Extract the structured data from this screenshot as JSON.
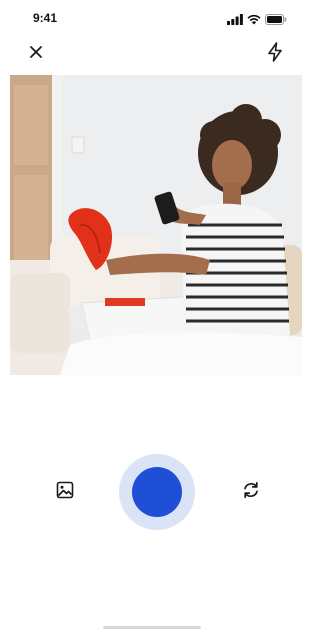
{
  "status_bar": {
    "time": "9:41",
    "icons": [
      "cellular-signal-icon",
      "wifi-icon",
      "battery-icon"
    ]
  },
  "top_bar": {
    "close_icon": "close-icon",
    "flash_icon": "flash-icon"
  },
  "viewfinder": {
    "subject_icon": "photo-preview"
  },
  "controls": {
    "gallery_icon": "gallery-icon",
    "shutter_icon": "shutter-button",
    "flip_icon": "flip-camera-icon"
  },
  "colors": {
    "shutter_inner": "#1f4fd6",
    "shutter_ring": "#dbe4f7",
    "icon": "#1a1a1a",
    "background": "#ffffff"
  }
}
